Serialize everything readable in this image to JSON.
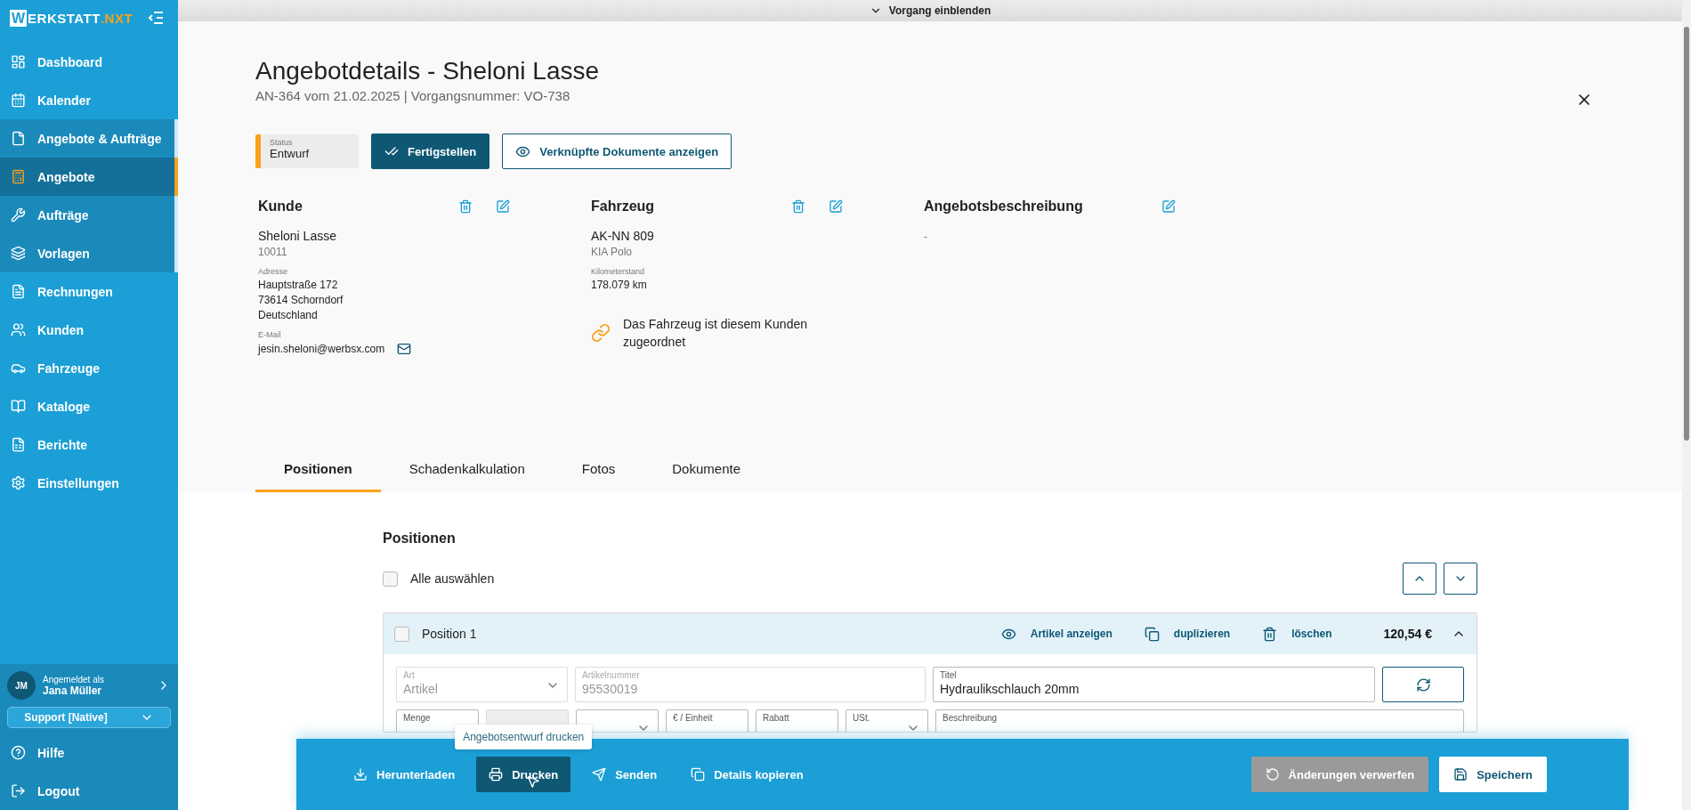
{
  "sidebar": {
    "logo": {
      "mark": "W",
      "text": "ERKSTATT",
      "suffix": ".NXT"
    },
    "items": [
      {
        "label": "Dashboard",
        "selected": false
      },
      {
        "label": "Kalender",
        "selected": false
      },
      {
        "label": "Angebote & Aufträge",
        "selected": false,
        "expanded": true,
        "children": [
          {
            "label": "Angebote",
            "selected": true
          },
          {
            "label": "Aufträge",
            "selected": false
          },
          {
            "label": "Vorlagen",
            "selected": false
          }
        ]
      },
      {
        "label": "Rechnungen",
        "selected": false
      },
      {
        "label": "Kunden",
        "selected": false
      },
      {
        "label": "Fahrzeuge",
        "selected": false
      },
      {
        "label": "Kataloge",
        "selected": false
      },
      {
        "label": "Berichte",
        "selected": false
      },
      {
        "label": "Einstellungen",
        "selected": false
      }
    ],
    "user": {
      "initials": "JM",
      "caption": "Angemeldet als",
      "name": "Jana Müller",
      "role": "Support [Native]"
    },
    "footer": [
      {
        "label": "Hilfe"
      },
      {
        "label": "Logout"
      }
    ]
  },
  "toggle": "Vorgang einblenden",
  "header": {
    "title": "Angebotdetails - Sheloni Lasse",
    "subtitle": "AN-364 vom 21.02.2025 | Vorgangsnummer: VO-738",
    "status": {
      "label": "Status",
      "value": "Entwurf"
    },
    "actions": [
      {
        "label": "Fertigstellen",
        "kind": "primary"
      },
      {
        "label": "Verknüpfte Dokumente anzeigen",
        "kind": "outline"
      }
    ]
  },
  "sections": [
    {
      "title": "Kunde",
      "deletable": true,
      "lines": [
        {
          "kind": "main",
          "text": "Sheloni Lasse"
        },
        {
          "kind": "sub",
          "text": "10011"
        },
        {
          "kind": "label",
          "text": "Adresse"
        },
        {
          "kind": "value",
          "text": "Hauptstraße 172"
        },
        {
          "kind": "value",
          "text": "73614 Schorndorf"
        },
        {
          "kind": "value",
          "text": "Deutschland"
        },
        {
          "kind": "label",
          "text": "E-Mail"
        },
        {
          "kind": "email",
          "text": "jesin.sheloni@werbsx.com"
        }
      ]
    },
    {
      "title": "Fahrzeug",
      "deletable": true,
      "lines": [
        {
          "kind": "main",
          "text": "AK-NN 809"
        },
        {
          "kind": "sub",
          "text": "KIA Polo"
        },
        {
          "kind": "label",
          "text": "Kilometerstand"
        },
        {
          "kind": "value",
          "text": "178.079 km"
        },
        {
          "kind": "link",
          "text": "Das Fahrzeug ist diesem Kunden zugeordnet"
        }
      ]
    },
    {
      "title": "Angebotsbeschreibung",
      "deletable": false,
      "lines": [
        {
          "kind": "sub",
          "text": "-"
        }
      ]
    }
  ],
  "tabs": [
    {
      "label": "Positionen",
      "selected": true
    },
    {
      "label": "Schadenkalkulation",
      "selected": false
    },
    {
      "label": "Fotos",
      "selected": false
    },
    {
      "label": "Dokumente",
      "selected": false
    }
  ],
  "positions": {
    "heading": "Positionen",
    "select_all": {
      "label": "Alle auswählen",
      "checked": false
    },
    "items": [
      {
        "title": "Position 1",
        "checked": false,
        "expanded": true,
        "price": "120,54 €",
        "actions": [
          {
            "label": "Artikel anzeigen",
            "kind": "view"
          },
          {
            "label": "duplizieren",
            "kind": "copy"
          },
          {
            "label": "löschen",
            "kind": "delete"
          }
        ],
        "row1": [
          {
            "label": "Art",
            "value": "Artikel",
            "disabled": true,
            "kind": "select"
          },
          {
            "label": "Artikelnummer",
            "value": "95530019",
            "disabled": true,
            "kind": "text"
          },
          {
            "label": "Titel",
            "value": "Hydraulikschlauch 20mm",
            "disabled": false,
            "kind": "text"
          }
        ],
        "row2": [
          {
            "label": "Menge",
            "disabled": false,
            "kind": "text"
          },
          {
            "disabled": true,
            "kind": "text"
          },
          {
            "disabled": false,
            "kind": "select"
          },
          {
            "label": "€ / Einheit",
            "disabled": false,
            "kind": "text"
          },
          {
            "label": "Rabatt",
            "disabled": false,
            "kind": "text"
          },
          {
            "label": "USt.",
            "disabled": false,
            "kind": "select"
          },
          {
            "label": "Beschreibung",
            "disabled": false,
            "kind": "text"
          }
        ]
      }
    ]
  },
  "bottom_bar": {
    "left": [
      {
        "label": "Herunterladen",
        "kind": "download",
        "hover": false
      },
      {
        "label": "Drucken",
        "kind": "print",
        "hover": true
      },
      {
        "label": "Senden",
        "kind": "send",
        "hover": false
      },
      {
        "label": "Details kopieren",
        "kind": "copy",
        "hover": false
      }
    ],
    "right": [
      {
        "label": "Änderungen verwerfen",
        "kind": "discard"
      },
      {
        "label": "Speichern",
        "kind": "save"
      }
    ],
    "tooltip": "Angebotsentwurf drucken"
  }
}
